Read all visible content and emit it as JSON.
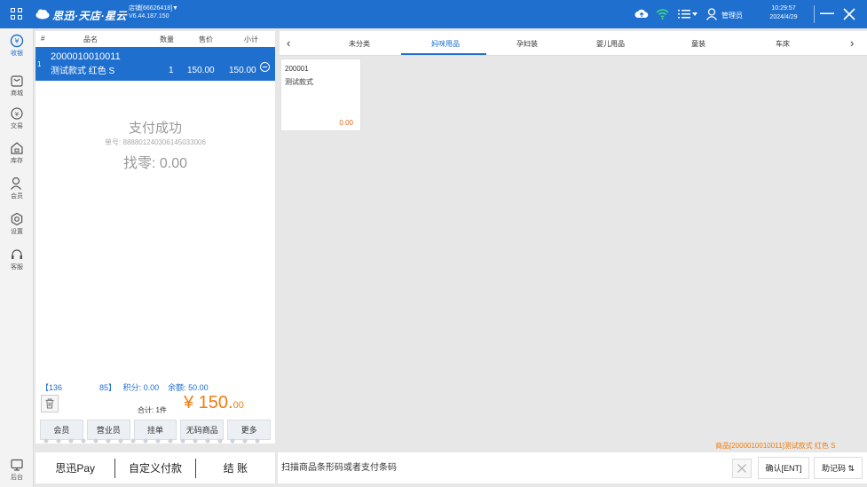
{
  "topbar": {
    "brand": "思迅·天店·星云",
    "store_line1": "店铺[66626418]▼",
    "store_line2": "V6.44.187.150",
    "user_label": "管理员",
    "time": "10:29:57",
    "date": "2024/4/29"
  },
  "sidebar": {
    "items": [
      {
        "label": "收银"
      },
      {
        "label": "商城"
      },
      {
        "label": "交易"
      },
      {
        "label": "库存"
      },
      {
        "label": "会员"
      },
      {
        "label": "设置"
      },
      {
        "label": "客服"
      }
    ],
    "bottom_label": "后台"
  },
  "cart": {
    "headers": {
      "index": "#",
      "name": "品名",
      "qty": "数量",
      "price": "售价",
      "subtotal": "小计"
    },
    "items": [
      {
        "index": "1",
        "code": "2000010010011",
        "name": "测试款式 红色 S",
        "qty": "1",
        "price": "150.00",
        "subtotal": "150.00"
      }
    ],
    "pay_status": "支付成功",
    "order_no": "单号: 888801240306145033006",
    "change": "找零: 0.00",
    "member": {
      "phone_prefix": "【136",
      "phone_suffix": "85】",
      "points": "积分: 0.00",
      "balance": "余额: 50.00"
    },
    "total_label": "合计: 1件",
    "total_int": "¥ 150.",
    "total_dec": "00",
    "actions": [
      "会员",
      "营业员",
      "挂单",
      "无码商品",
      "更多"
    ]
  },
  "pay": {
    "buttons": [
      "思迅Pay",
      "自定义付款",
      "结 账"
    ]
  },
  "categories": {
    "tabs": [
      "未分类",
      "妈咪用品",
      "孕妇装",
      "婴儿用品",
      "童装",
      "车床"
    ],
    "active": 1
  },
  "products": [
    {
      "code": "200001",
      "name": "测试款式",
      "price": "0.00"
    }
  ],
  "status_message": "商品[2000010010011]测试款式 红色 S",
  "scan": {
    "placeholder": "扫描商品条形码或者支付条码",
    "confirm_label": "确认[ENT]",
    "help_label": "助记码 ⇅"
  },
  "colors": {
    "primary": "#1f6fcf",
    "accent": "#f07d0f"
  }
}
